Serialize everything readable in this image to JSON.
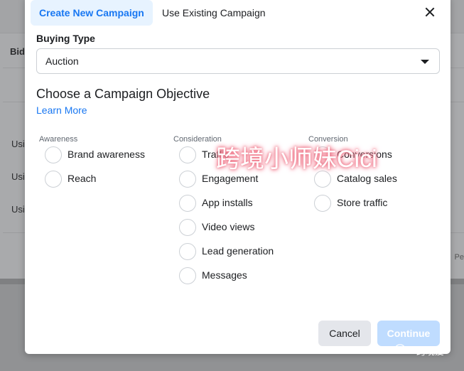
{
  "background": {
    "column_header": "Bid",
    "row_labels": [
      "Usi",
      "Usi",
      "Usi"
    ],
    "pager_text": "Pe"
  },
  "modal": {
    "tabs": [
      {
        "label": "Create New Campaign",
        "active": true
      },
      {
        "label": "Use Existing Campaign",
        "active": false
      }
    ],
    "buying_type": {
      "label": "Buying Type",
      "value": "Auction"
    },
    "objective": {
      "title": "Choose a Campaign Objective",
      "learn_more": "Learn More",
      "columns": [
        {
          "heading": "Awareness",
          "options": [
            "Brand awareness",
            "Reach"
          ]
        },
        {
          "heading": "Consideration",
          "options": [
            "Traffic",
            "Engagement",
            "App installs",
            "Video views",
            "Lead generation",
            "Messages"
          ]
        },
        {
          "heading": "Conversion",
          "options": [
            "Conversions",
            "Catalog sales",
            "Store traffic"
          ]
        }
      ]
    },
    "footer": {
      "cancel_label": "Cancel",
      "continue_label": "Continue"
    }
  },
  "watermark": {
    "text": "跨境小师妹Cici",
    "corner_text": "跨境爱"
  },
  "colors": {
    "accent": "#1877f2",
    "active_tab_bg": "#e7f3ff",
    "continue_disabled": "#bfdcff",
    "watermark_glow": "#f07a8c"
  }
}
